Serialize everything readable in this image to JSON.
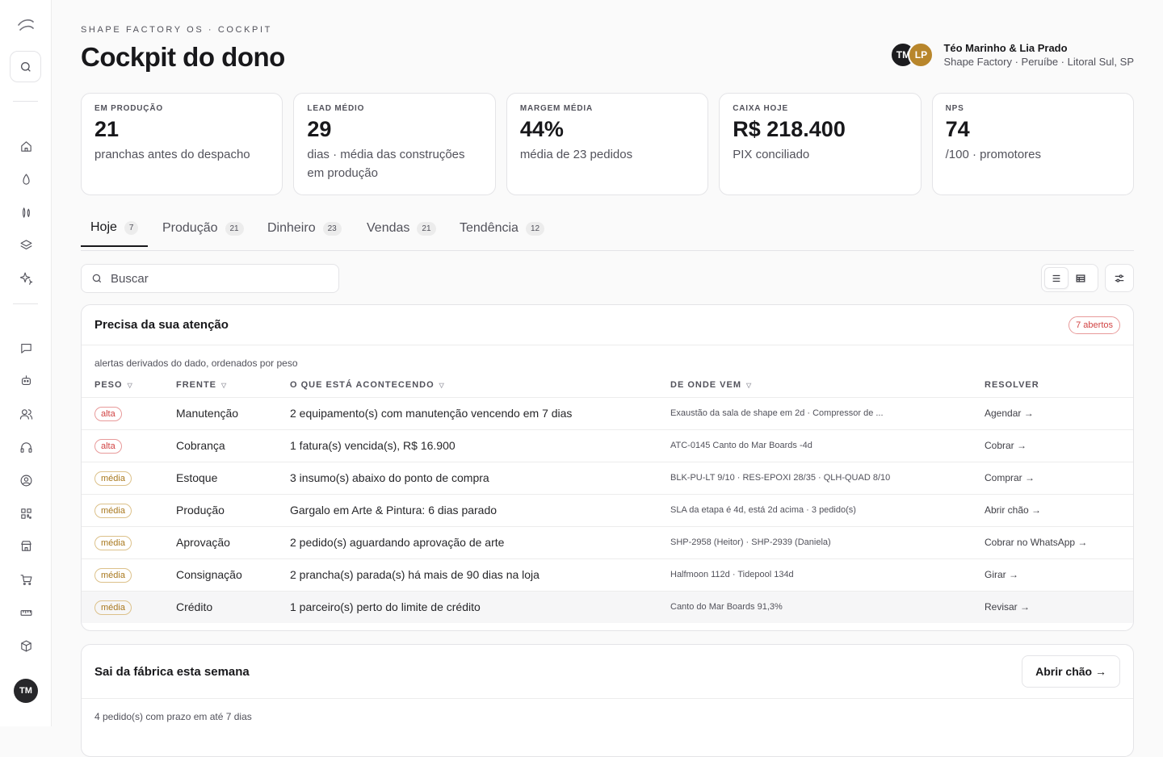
{
  "sidebar": {
    "avatar": "TM",
    "icons": [
      "home-icon",
      "drop-icon",
      "shapes-icon",
      "layers-icon",
      "sparkles-icon",
      "chat-icon",
      "bot-icon",
      "users-icon",
      "headset-icon",
      "user-circle-icon",
      "qr-icon",
      "store-icon",
      "cart-icon",
      "ruler-icon",
      "box-icon"
    ]
  },
  "header": {
    "eyebrow": "SHAPE FACTORY OS · COCKPIT",
    "title": "Cockpit do dono",
    "user": {
      "initials_1": "TM",
      "initials_2": "LP",
      "name": "Téo Marinho & Lia Prado",
      "location": "Shape Factory · Peruíbe · Litoral Sul, SP"
    }
  },
  "kpis": [
    {
      "label": "EM PRODUÇÃO",
      "value": "21",
      "sub": "pranchas antes do despacho"
    },
    {
      "label": "LEAD MÉDIO",
      "value": "29",
      "sub": "dias · média das construções em produção"
    },
    {
      "label": "MARGEM MÉDIA",
      "value": "44%",
      "sub": "média de 23 pedidos"
    },
    {
      "label": "CAIXA HOJE",
      "value": "R$ 218.400",
      "sub": "PIX conciliado"
    },
    {
      "label": "NPS",
      "value": "74",
      "sub": "/100 · promotores"
    }
  ],
  "tabs": [
    {
      "label": "Hoje",
      "count": "7"
    },
    {
      "label": "Produção",
      "count": "21"
    },
    {
      "label": "Dinheiro",
      "count": "23"
    },
    {
      "label": "Vendas",
      "count": "21"
    },
    {
      "label": "Tendência",
      "count": "12"
    }
  ],
  "search": {
    "placeholder": "Buscar"
  },
  "attention": {
    "title": "Precisa da sua atenção",
    "badge": "7 abertos",
    "desc": "alertas derivados do dado, ordenados por peso",
    "columns": [
      "PESO",
      "FRENTE",
      "O QUE ESTÁ ACONTECENDO",
      "DE ONDE VEM",
      "RESOLVER"
    ],
    "rows": [
      {
        "peso": "alta",
        "frente": "Manutenção",
        "what": "2 equipamento(s) com manutenção vencendo em 7 dias",
        "from": "Exaustão da sala de shape em 2d · Compressor de ...",
        "action": "Agendar →"
      },
      {
        "peso": "alta",
        "frente": "Cobrança",
        "what": "1 fatura(s) vencida(s), R$ 16.900",
        "from": "ATC-0145 Canto do Mar Boards -4d",
        "action": "Cobrar →"
      },
      {
        "peso": "média",
        "frente": "Estoque",
        "what": "3 insumo(s) abaixo do ponto de compra",
        "from": "BLK-PU-LT 9/10 · RES-EPOXI 28/35 · QLH-QUAD 8/10",
        "action": "Comprar →"
      },
      {
        "peso": "média",
        "frente": "Produção",
        "what": "Gargalo em Arte & Pintura: 6 dias parado",
        "from": "SLA da etapa é 4d, está 2d acima · 3 pedido(s)",
        "action": "Abrir chão →"
      },
      {
        "peso": "média",
        "frente": "Aprovação",
        "what": "2 pedido(s) aguardando aprovação de arte",
        "from": "SHP-2958 (Heitor) · SHP-2939 (Daniela)",
        "action": "Cobrar no WhatsApp →"
      },
      {
        "peso": "média",
        "frente": "Consignação",
        "what": "2 prancha(s) parada(s) há mais de 90 dias na loja",
        "from": "Halfmoon 112d · Tidepool 134d",
        "action": "Girar →"
      },
      {
        "peso": "média",
        "frente": "Crédito",
        "what": "1 parceiro(s) perto do limite de crédito",
        "from": "Canto do Mar Boards 91,3%",
        "action": "Revisar →"
      }
    ]
  },
  "week": {
    "title": "Sai da fábrica esta semana",
    "button": "Abrir chão →",
    "desc": "4 pedido(s) com prazo em até 7 dias"
  },
  "colors": {
    "accent": "#18181b",
    "alta": "#d14343",
    "media": "#a9781e",
    "gold": "#b8862b"
  }
}
